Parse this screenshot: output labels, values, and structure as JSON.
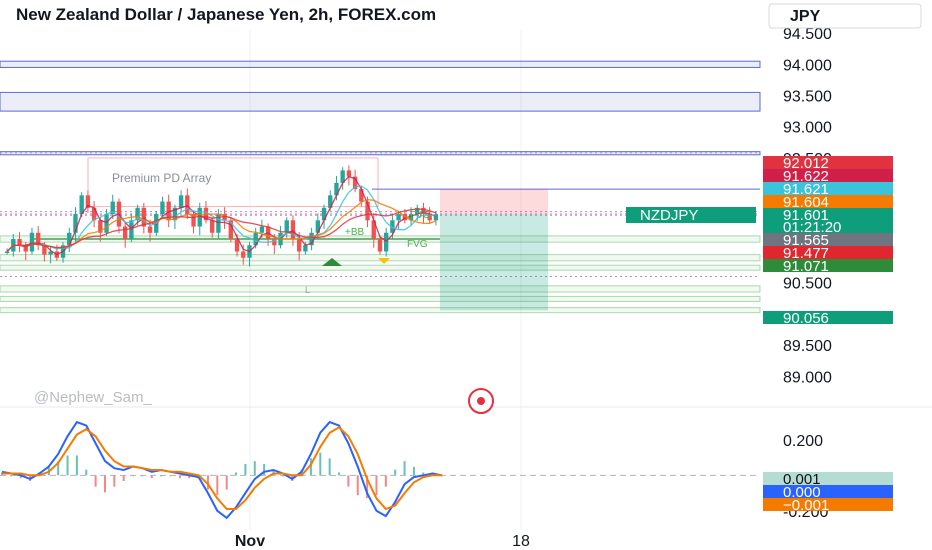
{
  "header": {
    "title": "New Zealand Dollar / Japanese Yen, 2h, FOREX.com",
    "currency_button": "JPY"
  },
  "watermark": "@Nephew_Sam_",
  "annotations": {
    "premium_label": "Premium PD Array",
    "fvg_label": "FVG",
    "bb_label": "+BB",
    "lq_label": "L"
  },
  "chart_data": [
    {
      "type": "line",
      "title": "New Zealand Dollar / Japanese Yen, 2h, FOREX.com",
      "symbol": "NZDJPY",
      "interval": "2h",
      "y_axis": {
        "currency": "JPY",
        "ticks": [
          "94.000",
          "93.500",
          "93.000",
          "92.500",
          "90.500",
          "89.500",
          "89.000"
        ],
        "range": [
          88.7,
          94.55
        ]
      },
      "x_axis": {
        "ticks": [
          "Nov",
          "18"
        ]
      },
      "price_tags": [
        {
          "label": "92.012",
          "value": 92.012,
          "color": "#e0323f"
        },
        {
          "label": "91.622",
          "value": 91.622,
          "color": "#d0204a"
        },
        {
          "label": "91.621",
          "value": 91.621,
          "color": "#3cc3dc"
        },
        {
          "label": "91.604",
          "value": 91.604,
          "color": "#f57b00"
        },
        {
          "label": "91.601",
          "value": 91.601,
          "color": "#0f9e7b"
        },
        {
          "label": "01:21:20",
          "value": null,
          "color": "#0f9e7b"
        },
        {
          "label": "91.565",
          "value": 91.565,
          "color": "#707480"
        },
        {
          "label": "91.477",
          "value": 91.477,
          "color": "#e0262e"
        },
        {
          "label": "91.071",
          "value": 91.071,
          "color": "#2e8b3a"
        },
        {
          "label": "90.056",
          "value": 90.056,
          "color": "#0f9e7b"
        }
      ],
      "symbol_tag": "NZDJPY",
      "horizontal_zones": [
        {
          "top": 94.05,
          "bottom": 93.95
        },
        {
          "top": 93.55,
          "bottom": 93.25
        },
        {
          "top": 92.6,
          "bottom": 92.55
        }
      ],
      "position": {
        "entry": 91.601,
        "stop": 92.0,
        "target": 90.056
      },
      "close_approx": [
        91.0,
        91.2,
        91.1,
        91.0,
        91.3,
        91.1,
        90.95,
        91.0,
        90.9,
        91.1,
        91.3,
        91.6,
        91.9,
        91.7,
        91.5,
        91.3,
        91.6,
        91.8,
        91.4,
        91.2,
        91.5,
        91.7,
        91.4,
        91.3,
        91.6,
        91.8,
        91.5,
        91.7,
        91.9,
        91.6,
        91.4,
        91.7,
        91.5,
        91.3,
        91.6,
        91.5,
        91.2,
        91.0,
        90.9,
        91.1,
        91.3,
        91.4,
        91.2,
        91.1,
        91.3,
        91.5,
        91.2,
        91.0,
        91.1,
        91.3,
        91.5,
        91.7,
        91.9,
        92.1,
        92.3,
        92.2,
        92.0,
        91.8,
        91.5,
        91.2,
        91.0,
        91.3,
        91.5,
        91.6,
        91.5,
        91.6,
        91.7,
        91.6,
        91.5,
        91.6
      ]
    },
    {
      "type": "line",
      "title": "",
      "y_axis": {
        "ticks": [
          "0.200",
          "-0.200"
        ],
        "range": [
          -0.28,
          0.34
        ]
      },
      "price_tags": [
        {
          "label": "0.001",
          "value": 0.001,
          "color": "#b4dcd2",
          "text_color": "#111111"
        },
        {
          "label": "0.000",
          "value": 0.0,
          "color": "#2962ff",
          "text_color": "#ffffff"
        },
        {
          "label": "−0.001",
          "value": -0.001,
          "color": "#f57b00",
          "text_color": "#ffffff"
        }
      ],
      "series": [
        {
          "values": [
            0.02,
            0.01,
            0.0,
            -0.02,
            0.01,
            0.05,
            0.12,
            0.22,
            0.3,
            0.28,
            0.18,
            0.08,
            0.04,
            0.03,
            0.05,
            0.04,
            0.02,
            0.03,
            0.02,
            0.01,
            0.0,
            -0.01,
            -0.1,
            -0.2,
            -0.24,
            -0.18,
            -0.1,
            -0.02,
            0.02,
            0.03,
            0.01,
            -0.02,
            0.02,
            0.12,
            0.24,
            0.3,
            0.28,
            0.18,
            0.05,
            -0.1,
            -0.2,
            -0.23,
            -0.15,
            -0.05,
            -0.01,
            0.0,
            0.01,
            0.0
          ],
          "color": "#2962ff"
        },
        {
          "values": [
            0.01,
            0.01,
            0.01,
            0.0,
            0.0,
            0.02,
            0.07,
            0.15,
            0.23,
            0.26,
            0.22,
            0.14,
            0.08,
            0.05,
            0.05,
            0.04,
            0.03,
            0.03,
            0.02,
            0.02,
            0.01,
            0.0,
            -0.05,
            -0.13,
            -0.19,
            -0.19,
            -0.14,
            -0.07,
            -0.02,
            0.01,
            0.01,
            0.0,
            0.0,
            0.06,
            0.16,
            0.24,
            0.27,
            0.22,
            0.12,
            -0.02,
            -0.13,
            -0.19,
            -0.17,
            -0.1,
            -0.04,
            -0.01,
            0.0,
            0.0
          ],
          "color": "#f57b00"
        }
      ]
    }
  ],
  "colors": {
    "up": "#26a69a",
    "down": "#ef5350",
    "zone": "#5b6ad0",
    "green_zone": "#4caf50",
    "accent": "#0f9e7b"
  }
}
